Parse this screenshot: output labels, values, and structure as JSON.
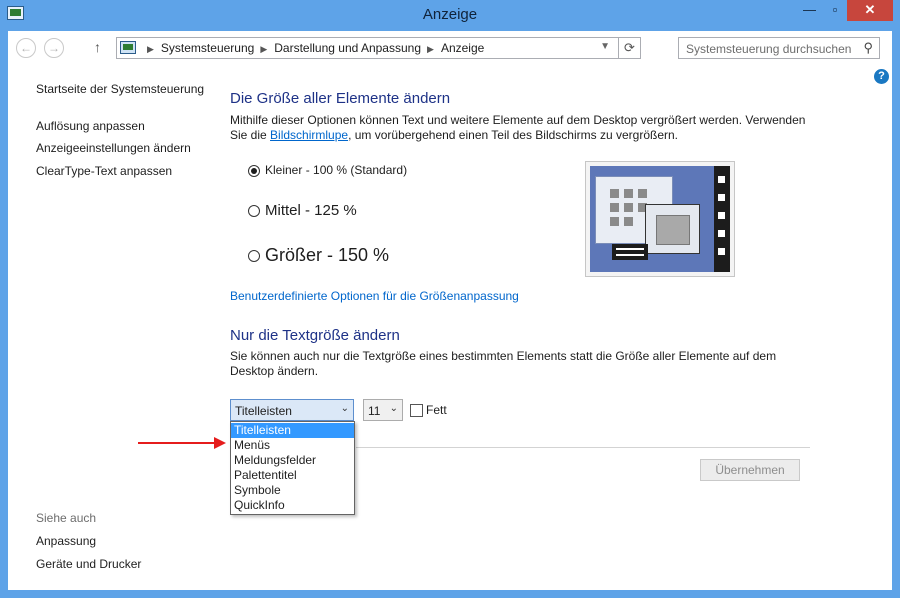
{
  "window": {
    "title": "Anzeige",
    "minimize_glyph": "—",
    "maximize_glyph": "▫",
    "close_glyph": "✕"
  },
  "navbar": {
    "back_icon": "arrow-left-icon",
    "forward_icon": "arrow-right-icon",
    "up_icon": "arrow-up-icon",
    "breadcrumbs": [
      "Systemsteuerung",
      "Darstellung und Anpassung",
      "Anzeige"
    ],
    "search_placeholder": "Systemsteuerung durchsuchen"
  },
  "sidebar": {
    "home": "Startseite der Systemsteuerung",
    "items": [
      "Auflösung anpassen",
      "Anzeigeeinstellungen ändern",
      "ClearType-Text anpassen"
    ],
    "see_also_heading": "Siehe auch",
    "see_also": [
      "Anpassung",
      "Geräte und Drucker"
    ]
  },
  "main": {
    "section1": {
      "heading": "Die Größe aller Elemente ändern",
      "text_before_link": "Mithilfe dieser Optionen können Text und weitere Elemente auf dem Desktop vergrößert werden. Verwenden Sie die ",
      "link": "Bildschirmlupe",
      "text_after_link": ", um vorübergehend einen Teil des Bildschirms zu vergrößern.",
      "options": [
        {
          "label": "Kleiner - 100 % (Standard)",
          "selected": true
        },
        {
          "label": "Mittel - 125 %",
          "selected": false
        },
        {
          "label": "Größer - 150 %",
          "selected": false
        }
      ],
      "custom_link": "Benutzerdefinierte Optionen für die Größenanpassung"
    },
    "section2": {
      "heading": "Nur die Textgröße ändern",
      "text": "Sie können auch nur die Textgröße eines bestimmten Elements statt die Größe aller Elemente auf dem Desktop ändern.",
      "element_select": "Titelleisten",
      "size_select": "11",
      "bold_label": "Fett",
      "bold_checked": false,
      "dropdown_options": [
        "Titelleisten",
        "Menüs",
        "Meldungsfelder",
        "Palettentitel",
        "Symbole",
        "QuickInfo"
      ],
      "dropdown_selected": "Titelleisten"
    },
    "apply_button": "Übernehmen"
  },
  "colors": {
    "frame": "#5ea3e8",
    "heading": "#1e3287",
    "link": "#0066cc",
    "selection": "#3399ff",
    "annotation_arrow": "#e51c1c"
  }
}
